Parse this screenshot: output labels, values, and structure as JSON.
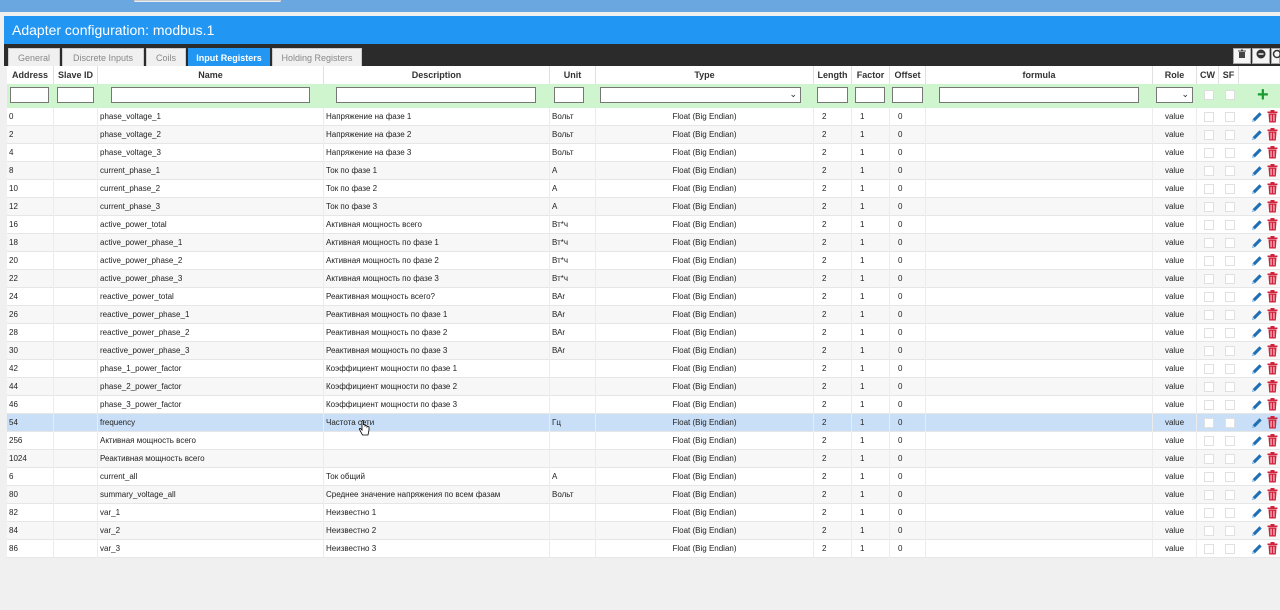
{
  "window": {
    "title": "Adapter configuration: modbus.1"
  },
  "tabs": [
    {
      "label": "General",
      "active": false
    },
    {
      "label": "Discrete Inputs",
      "active": false
    },
    {
      "label": "Coils",
      "active": false
    },
    {
      "label": "Input Registers",
      "active": true
    },
    {
      "label": "Holding Registers",
      "active": false
    }
  ],
  "toolbar_icons": [
    "trash-icon",
    "minus-circle-icon",
    "refresh-icon"
  ],
  "columns": {
    "address": "Address",
    "slave_id": "Slave ID",
    "name": "Name",
    "description": "Description",
    "unit": "Unit",
    "type": "Type",
    "length": "Length",
    "factor": "Factor",
    "offset": "Offset",
    "formula": "formula",
    "role": "Role",
    "cw": "CW",
    "sf": "SF"
  },
  "colors": {
    "accent": "#2196f3",
    "filter_row": "#cff5cf",
    "selected_row": "#c9dff7",
    "add": "#1b9a2f",
    "delete": "#d0223a",
    "edit": "#1f6fb5"
  },
  "rows": [
    {
      "address": "0",
      "name": "phase_voltage_1",
      "description": "Напряжение на фазе 1",
      "unit": "Вольт",
      "type": "Float (Big Endian)",
      "length": "2",
      "factor": "1",
      "offset": "0",
      "role": "value"
    },
    {
      "address": "2",
      "name": "phase_voltage_2",
      "description": "Напряжение на фазе 2",
      "unit": "Вольт",
      "type": "Float (Big Endian)",
      "length": "2",
      "factor": "1",
      "offset": "0",
      "role": "value"
    },
    {
      "address": "4",
      "name": "phase_voltage_3",
      "description": "Напряжение на фазе 3",
      "unit": "Вольт",
      "type": "Float (Big Endian)",
      "length": "2",
      "factor": "1",
      "offset": "0",
      "role": "value"
    },
    {
      "address": "8",
      "name": "current_phase_1",
      "description": "Ток по фазе 1",
      "unit": "А",
      "type": "Float (Big Endian)",
      "length": "2",
      "factor": "1",
      "offset": "0",
      "role": "value"
    },
    {
      "address": "10",
      "name": "current_phase_2",
      "description": "Ток по фазе 2",
      "unit": "А",
      "type": "Float (Big Endian)",
      "length": "2",
      "factor": "1",
      "offset": "0",
      "role": "value"
    },
    {
      "address": "12",
      "name": "current_phase_3",
      "description": "Ток по фазе 3",
      "unit": "А",
      "type": "Float (Big Endian)",
      "length": "2",
      "factor": "1",
      "offset": "0",
      "role": "value"
    },
    {
      "address": "16",
      "name": "active_power_total",
      "description": "Активная мощность всего",
      "unit": "Вт*ч",
      "type": "Float (Big Endian)",
      "length": "2",
      "factor": "1",
      "offset": "0",
      "role": "value"
    },
    {
      "address": "18",
      "name": "active_power_phase_1",
      "description": "Активная мощность по фазе 1",
      "unit": "Вт*ч",
      "type": "Float (Big Endian)",
      "length": "2",
      "factor": "1",
      "offset": "0",
      "role": "value"
    },
    {
      "address": "20",
      "name": "active_power_phase_2",
      "description": "Активная мощность по фазе 2",
      "unit": "Вт*ч",
      "type": "Float (Big Endian)",
      "length": "2",
      "factor": "1",
      "offset": "0",
      "role": "value"
    },
    {
      "address": "22",
      "name": "active_power_phase_3",
      "description": "Активная мощность по фазе 3",
      "unit": "Вт*ч",
      "type": "Float (Big Endian)",
      "length": "2",
      "factor": "1",
      "offset": "0",
      "role": "value"
    },
    {
      "address": "24",
      "name": "reactive_power_total",
      "description": "Реактивная мощность всего?",
      "unit": "ВАr",
      "type": "Float (Big Endian)",
      "length": "2",
      "factor": "1",
      "offset": "0",
      "role": "value"
    },
    {
      "address": "26",
      "name": "reactive_power_phase_1",
      "description": "Реактивная мощность по фазе 1",
      "unit": "ВАr",
      "type": "Float (Big Endian)",
      "length": "2",
      "factor": "1",
      "offset": "0",
      "role": "value"
    },
    {
      "address": "28",
      "name": "reactive_power_phase_2",
      "description": "Реактивная мощность по фазе 2",
      "unit": "ВАr",
      "type": "Float (Big Endian)",
      "length": "2",
      "factor": "1",
      "offset": "0",
      "role": "value"
    },
    {
      "address": "30",
      "name": "reactive_power_phase_3",
      "description": "Реактивная мощность по фазе 3",
      "unit": "ВАr",
      "type": "Float (Big Endian)",
      "length": "2",
      "factor": "1",
      "offset": "0",
      "role": "value"
    },
    {
      "address": "42",
      "name": "phase_1_power_factor",
      "description": "Коэффициент мощности по фазе 1",
      "unit": "",
      "type": "Float (Big Endian)",
      "length": "2",
      "factor": "1",
      "offset": "0",
      "role": "value"
    },
    {
      "address": "44",
      "name": "phase_2_power_factor",
      "description": "Коэффициент мощности по фазе 2",
      "unit": "",
      "type": "Float (Big Endian)",
      "length": "2",
      "factor": "1",
      "offset": "0",
      "role": "value"
    },
    {
      "address": "46",
      "name": "phase_3_power_factor",
      "description": "Коэффициент мощности по фазе 3",
      "unit": "",
      "type": "Float (Big Endian)",
      "length": "2",
      "factor": "1",
      "offset": "0",
      "role": "value"
    },
    {
      "address": "54",
      "name": "frequency",
      "description": "Частота сети",
      "unit": "Гц",
      "type": "Float (Big Endian)",
      "length": "2",
      "factor": "1",
      "offset": "0",
      "role": "value",
      "selected": true
    },
    {
      "address": "256",
      "name": "Активная мощность всего",
      "description": "",
      "unit": "",
      "type": "Float (Big Endian)",
      "length": "2",
      "factor": "1",
      "offset": "0",
      "role": "value"
    },
    {
      "address": "1024",
      "name": "Реактивная мощность всего",
      "description": "",
      "unit": "",
      "type": "Float (Big Endian)",
      "length": "2",
      "factor": "1",
      "offset": "0",
      "role": "value"
    },
    {
      "address": "6",
      "name": "current_all",
      "description": "Ток общий",
      "unit": "А",
      "type": "Float (Big Endian)",
      "length": "2",
      "factor": "1",
      "offset": "0",
      "role": "value"
    },
    {
      "address": "80",
      "name": "summary_voltage_all",
      "description": "Среднее значение напряжения по всем фазам",
      "unit": "Вольт",
      "type": "Float (Big Endian)",
      "length": "2",
      "factor": "1",
      "offset": "0",
      "role": "value"
    },
    {
      "address": "82",
      "name": "var_1",
      "description": "Неизвестно 1",
      "unit": "",
      "type": "Float (Big Endian)",
      "length": "2",
      "factor": "1",
      "offset": "0",
      "role": "value"
    },
    {
      "address": "84",
      "name": "var_2",
      "description": "Неизвестно 2",
      "unit": "",
      "type": "Float (Big Endian)",
      "length": "2",
      "factor": "1",
      "offset": "0",
      "role": "value"
    },
    {
      "address": "86",
      "name": "var_3",
      "description": "Неизвестно 3",
      "unit": "",
      "type": "Float (Big Endian)",
      "length": "2",
      "factor": "1",
      "offset": "0",
      "role": "value"
    }
  ]
}
